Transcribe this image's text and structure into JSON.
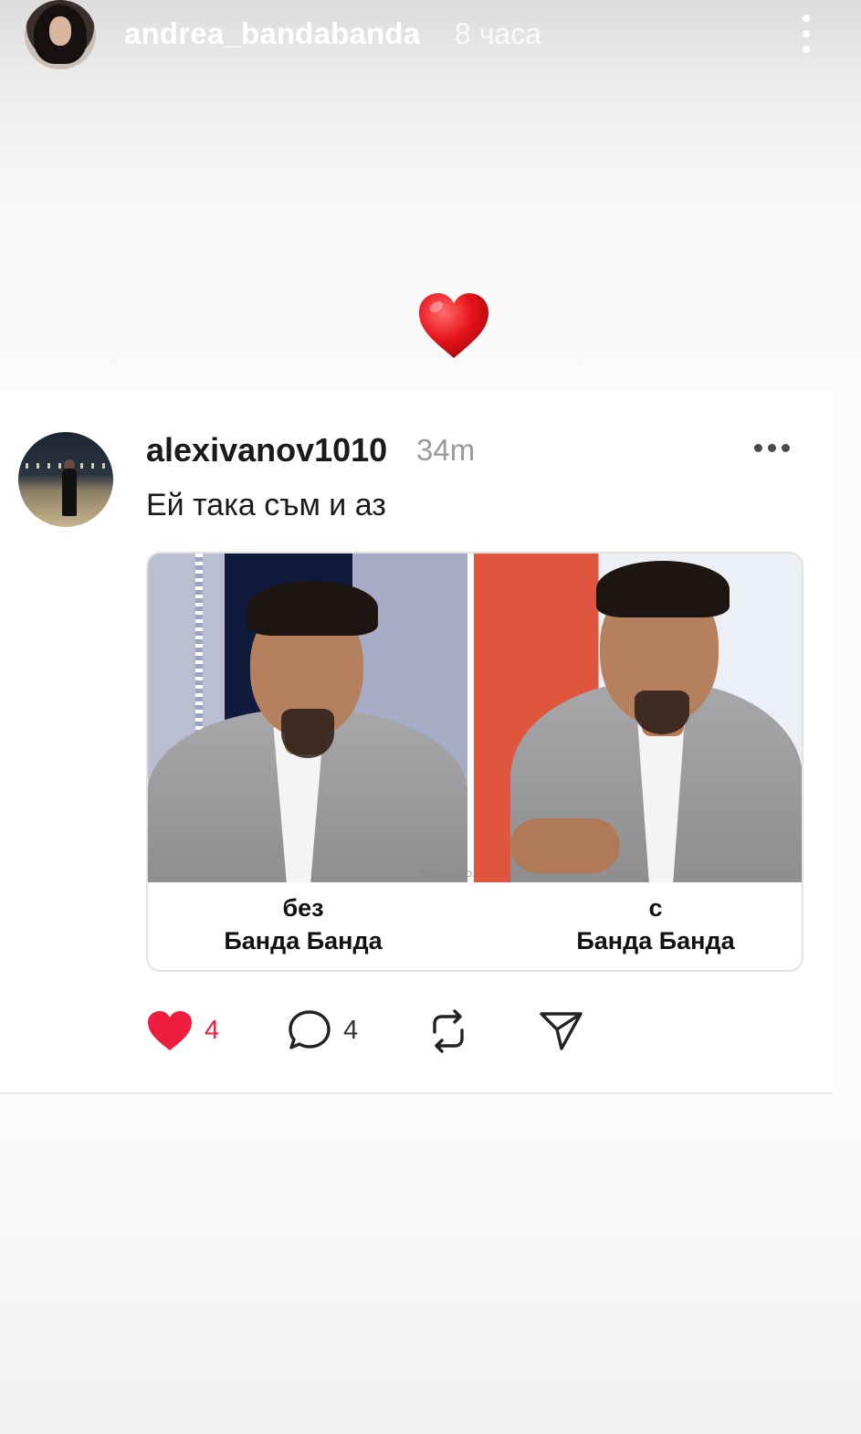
{
  "story": {
    "username": "andrea_bandabanda",
    "time": "8 часа"
  },
  "post": {
    "username": "alexivanov1010",
    "time": "34m",
    "caption": "Ей така съм и аз",
    "meme": {
      "watermark": "FUTBOLBRO.COM",
      "left_label_line1": "без",
      "left_label_line2": "Банда Банда",
      "right_label_line1": "с",
      "right_label_line2": "Банда Банда"
    },
    "actions": {
      "likes": "4",
      "comments": "4"
    }
  },
  "colors": {
    "like_red": "#ee1d3f",
    "text_dark": "#1a1a1a",
    "muted": "#9a9a9a"
  },
  "icons": [
    "more-vertical-icon",
    "heart-emoji-icon",
    "more-horizontal-icon",
    "heart-filled-icon",
    "comment-icon",
    "repost-icon",
    "share-send-icon"
  ]
}
